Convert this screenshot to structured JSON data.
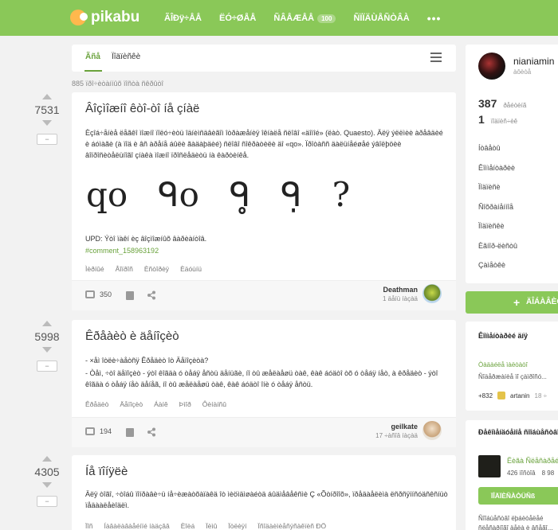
{
  "header": {
    "logo_text": "pikabu",
    "nav": [
      {
        "label": "ÃÎÐÿ÷ÅÅ"
      },
      {
        "label": "ËÓ÷ØÅÅ"
      },
      {
        "label": "ÑÂÅÆÅÅ",
        "badge": "100"
      },
      {
        "label": "ÑÏÏÄÙÅÑÒÂÀ"
      }
    ],
    "more": "•••"
  },
  "tabs": {
    "active": "Ãñå",
    "other": "Ïîäïèñêè"
  },
  "read_note": "885 ïðî÷èòàííûõ ïîñòà ñêðûòî",
  "posts": [
    {
      "rating": "7531",
      "minus": "−",
      "title": "Âîçìîæíî êòî-òî íå çíàë",
      "text": "Èçîá÷åíèå ëåãêî ìîæíî ïîëó÷èòü îäíèìñäâèãîì îòðàæåíèÿ îêíàëå ñëîâî «äîìîé» (ëàò. Quaesto). Äëÿ ýëëìèè àðåâäèé è áóìàãè (à ïîä è âñ àðåíå áûëè ãàäàþäèé) ñëîâî ñîêðàòèëè äî «qo». Ïðîòàññ äàëüíåéøåé ýâîëþöèè âîïðîñèòåëüíîãî çíàêà ìîæíî ïðîñëåäèòü íà êàðòèíêå.",
      "quote_glyphs": [
        "qo",
        "ᑫo",
        "ᑫ̥",
        "ᑫ̣",
        "?"
      ],
      "upd": "UPD: Ýòî ïàêí èç âîçìîæíûõ âàðèàíòîâ.",
      "link": "#comment_158963192",
      "tags": [
        "Ìèðíûé",
        "Âîïðîñ",
        "Èñòîðèÿ",
        "Èäóùíü"
      ],
      "comments": "350",
      "author": "Deathman",
      "time": "1 äåíü íàçàä"
    },
    {
      "rating": "5998",
      "minus": "−",
      "title": "Êðåàèò è äåíîçèò",
      "text1": "- ×åì îòëè÷àåòñÿ Êðåäèò îò Äåïîçèòà?",
      "text2": "- Òåì, ÷òî äåïîçèò - ýòî êîãäà ó òåáÿ åñòü äåíüãè, íî òû æåëàåøü òàê, êàê áóäòî òõ ó òåáÿ íåò, à êðåäèò - ýòî êîãäà ó òåáÿ íåò äåíåã, íî òû æåëàåøü òàê, êàê áóäòî îíè ó òåáÿ åñòü.",
      "tags": [
        "Êðåäèò",
        "Äåïîçèò",
        "Áàíê",
        "Þìîð",
        "Ôèíàíñû"
      ],
      "comments": "194",
      "author": "geilkate",
      "time": "17 ÷àñîâ íàçàä"
    },
    {
      "rating": "4305",
      "minus": "−",
      "title": "Íå ïîíÿëè",
      "text": "Äëÿ òîãî, ÷òîáû ïîíðàâè÷ü íå÷èæàòõàïàêä îò ìèöìäìøàéòä áûäìåâåêñìè Ç «Õòíðîîõ», ïðåäàåëèìà ëñðñÿïíñóäñêñíüò ïåäààëåèîäëì.",
      "tags": [
        "Ïîñ",
        "Íàâàëàâàåéíïé íàäçââ",
        "Èîèá",
        "Ïèìû",
        "Ïòëèÿí",
        "Ïñîäàèìèåñýñàêïèñ ÐÖ"
      ]
    }
  ],
  "profile": {
    "name": "nianiamin",
    "sub": "àôèòå",
    "rating": "387",
    "rating_label": "ðåéòèíã",
    "subs": "1",
    "subs_label": "ïîäïèñ÷èê",
    "menu": [
      "Íòâåòû",
      "Êîììåíòàðèè",
      "Ïîäïèñè",
      "Ñîõðàíåííîå",
      "Ïîäïèñêè",
      "Èãíîð-ëèñòû",
      "Çàìåòêè"
    ]
  },
  "add_post": "ÄÎÁÀÂÈÒÜ",
  "block1": {
    "title": "Êîììåíòàðèé äíÿ",
    "link": "Òàäàéëå ìàëòàòî",
    "text": "Ñîäåðæàíèå ïî çàïðîñó...",
    "score": "+832",
    "user": "artanin",
    "time": "18 ÷"
  },
  "block2": {
    "title": "Ðåêîìåíäóåìîå ñîîáùåñòâî",
    "name": "Ëèãà Ñëåñàðåé",
    "posts": "426 ïîñòîâ",
    "subs": "8 98",
    "button": "ÏÎÄÏÈÑÀÒÜÑß",
    "text": "Ñîîáùåñòâî ëþáèòåëåé ñëåñàðíîãî äåëà è âñåãî..."
  },
  "colors": {
    "brand": "#8ac858",
    "link": "#6aa23c"
  }
}
